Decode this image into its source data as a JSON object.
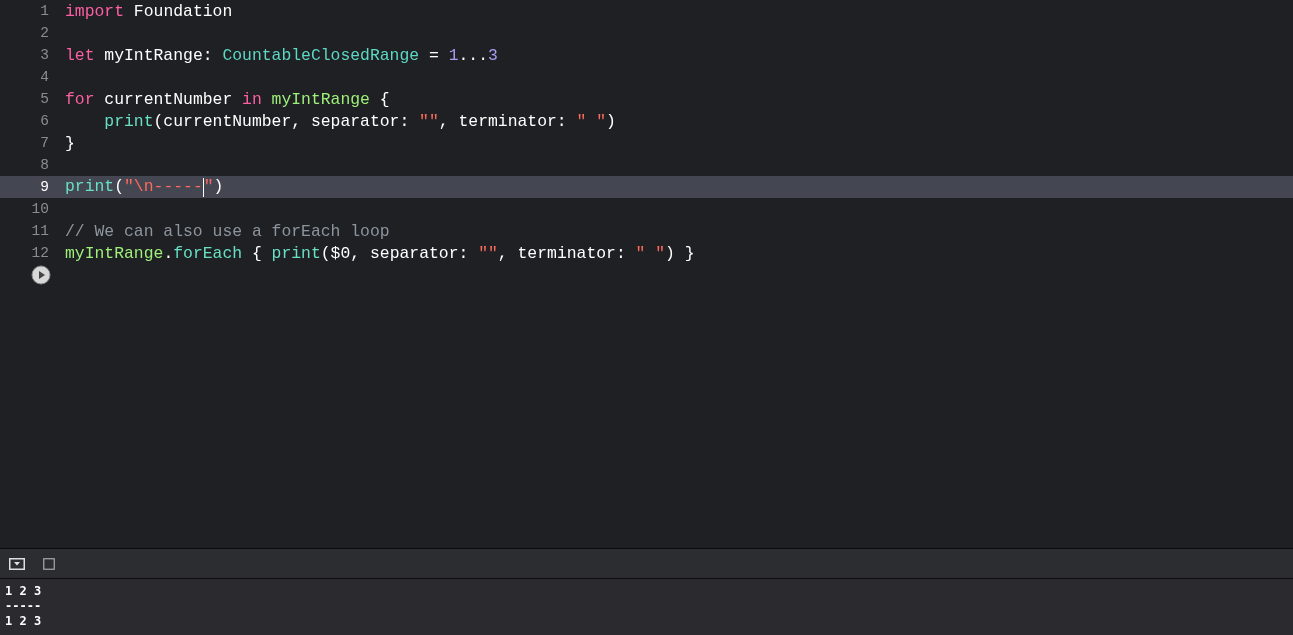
{
  "editor": {
    "lines": [
      {
        "number": "1",
        "current": false,
        "tokens": [
          {
            "kind": "keyword",
            "text": "import"
          },
          {
            "kind": "plain",
            "text": " Foundation"
          }
        ]
      },
      {
        "number": "2",
        "current": false
      },
      {
        "number": "3",
        "current": false,
        "tokens": [
          {
            "kind": "keyword",
            "text": "let"
          },
          {
            "kind": "plain",
            "text": " myIntRange: "
          },
          {
            "kind": "type",
            "text": "CountableClosedRange"
          },
          {
            "kind": "plain",
            "text": " = "
          },
          {
            "kind": "number",
            "text": "1"
          },
          {
            "kind": "plain",
            "text": "..."
          },
          {
            "kind": "number",
            "text": "3"
          }
        ]
      },
      {
        "number": "4",
        "current": false
      },
      {
        "number": "5",
        "current": false,
        "tokens": [
          {
            "kind": "keyword",
            "text": "for"
          },
          {
            "kind": "plain",
            "text": " currentNumber "
          },
          {
            "kind": "keyword",
            "text": "in"
          },
          {
            "kind": "variable",
            "text": " myIntRange"
          },
          {
            "kind": "plain",
            "text": " {"
          }
        ]
      },
      {
        "number": "6",
        "current": false,
        "tokens": [
          {
            "kind": "function",
            "text": "    print"
          },
          {
            "kind": "plain",
            "text": "(currentNumber, separator: "
          },
          {
            "kind": "string",
            "text": "\"\""
          },
          {
            "kind": "plain",
            "text": ", terminator: "
          },
          {
            "kind": "string",
            "text": "\" \""
          },
          {
            "kind": "plain",
            "text": ")"
          }
        ]
      },
      {
        "number": "7",
        "current": false,
        "tokens": [
          {
            "kind": "plain",
            "text": "}"
          }
        ]
      },
      {
        "number": "8",
        "current": false
      },
      {
        "number": "9",
        "current": true,
        "tokens": [
          {
            "kind": "function",
            "text": "print"
          },
          {
            "kind": "plain",
            "text": "("
          },
          {
            "kind": "string",
            "text": "\"\\n-----"
          },
          {
            "kind": "caret"
          },
          {
            "kind": "string",
            "text": "\""
          },
          {
            "kind": "plain",
            "text": ")"
          }
        ]
      },
      {
        "number": "10",
        "current": false
      },
      {
        "number": "11",
        "current": false,
        "tokens": [
          {
            "kind": "comment",
            "text": "// We can also use a forEach loop"
          }
        ]
      },
      {
        "number": "12",
        "current": false,
        "tokens": [
          {
            "kind": "variable",
            "text": "myIntRange"
          },
          {
            "kind": "plain",
            "text": "."
          },
          {
            "kind": "function",
            "text": "forEach"
          },
          {
            "kind": "plain",
            "text": " { "
          },
          {
            "kind": "function",
            "text": "print"
          },
          {
            "kind": "plain",
            "text": "($0, separator: "
          },
          {
            "kind": "string",
            "text": "\"\""
          },
          {
            "kind": "plain",
            "text": ", terminator: "
          },
          {
            "kind": "string",
            "text": "\" \""
          },
          {
            "kind": "plain",
            "text": ") }"
          }
        ]
      }
    ]
  },
  "console": {
    "output": [
      "1 2 3",
      "-----",
      "1 2 3"
    ]
  }
}
